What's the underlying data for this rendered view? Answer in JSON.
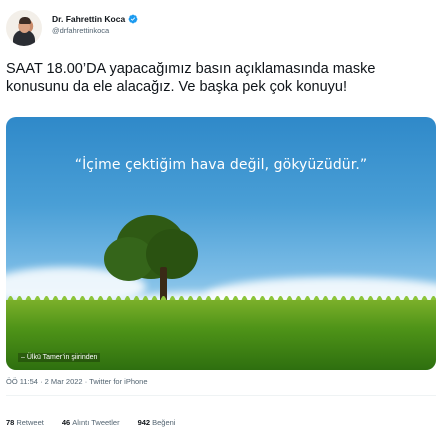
{
  "author": {
    "name": "Dr. Fahrettin Koca",
    "handle": "@drfahrettinkoca",
    "verified": true,
    "avatar_icon": "profile-photo"
  },
  "tweet": {
    "text": "SAAT 18.00’DA yapacağımız basın açıklamasında maske konusunu da ele alacağız. Ve başka pek çok konuyu!"
  },
  "media": {
    "quote": "“İçime çektiğim hava değil, gökyüzüdür.”",
    "caption": "– Ülkü Tamer’in şiirinden"
  },
  "meta": {
    "time": "ÖÖ 11:54",
    "separator1": "·",
    "date": "2 Mar 2022",
    "separator2": "·",
    "source": "Twitter for iPhone"
  },
  "stats": {
    "retweets_count": "78",
    "retweets_label": "Retweet",
    "quotes_count": "46",
    "quotes_label": "Alıntı Tweetler",
    "likes_count": "942",
    "likes_label": "Beğeni"
  },
  "colors": {
    "verified": "#1d9bf0",
    "text": "#0f1419",
    "secondary": "#536471"
  }
}
